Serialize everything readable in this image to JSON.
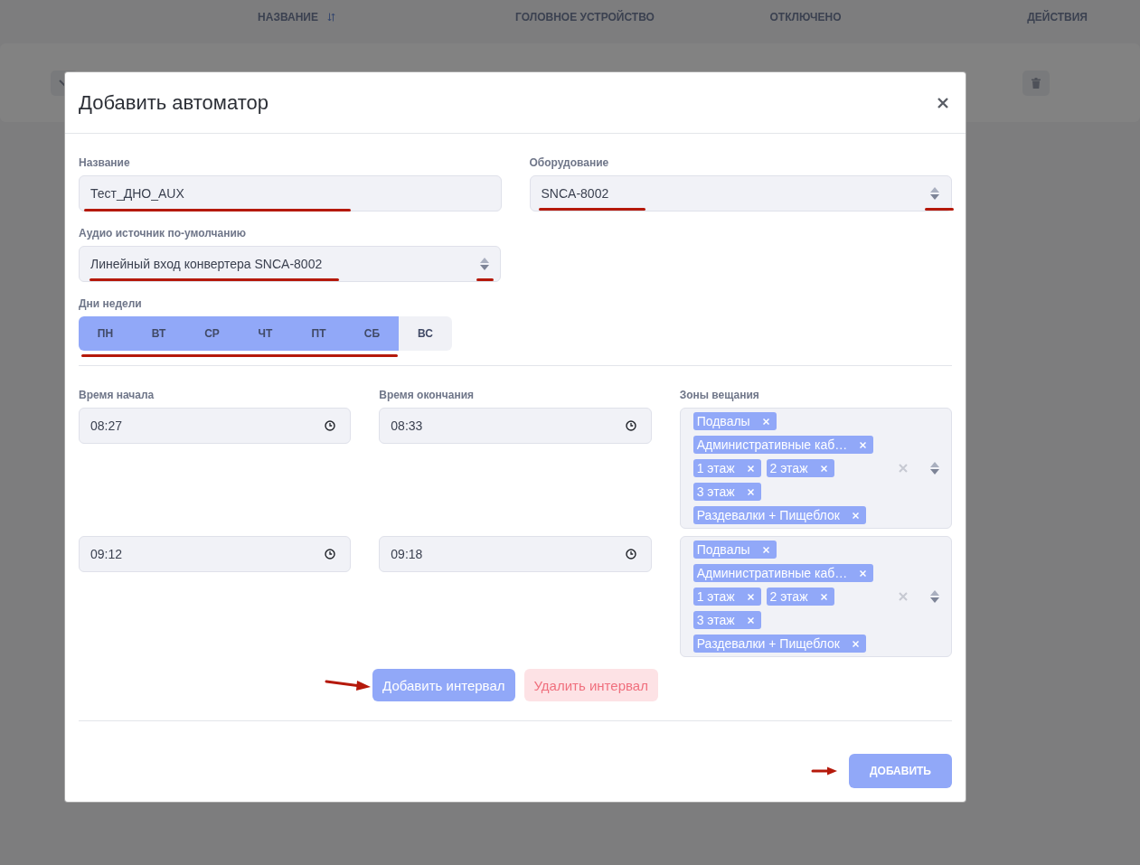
{
  "background_table": {
    "columns": [
      {
        "label": "НАЗВАНИЕ",
        "sortable": true
      },
      {
        "label": "ГОЛОВНОЕ УСТРОЙСТВО",
        "sortable": false
      },
      {
        "label": "ОТКЛЮЧЕНО",
        "sortable": false
      },
      {
        "label": "ДЕЙСТВИЯ",
        "sortable": false
      }
    ]
  },
  "dialog": {
    "title": "Добавить автоматор",
    "name_field": {
      "label": "Название",
      "value": "Тест_ДНО_AUX",
      "marked": true
    },
    "equipment_select": {
      "label": "Оборудование",
      "value": "SNCA-8002",
      "marked": true
    },
    "audio_source_select": {
      "label": "Аудио источник по-умолчанию",
      "value": "Линейный вход конвертера SNCA-8002",
      "marked": true
    },
    "weekdays": {
      "label": "Дни недели",
      "marked": true,
      "days": [
        {
          "label": "ПН",
          "selected": true
        },
        {
          "label": "ВТ",
          "selected": true
        },
        {
          "label": "СР",
          "selected": true
        },
        {
          "label": "ЧТ",
          "selected": true
        },
        {
          "label": "ПТ",
          "selected": true
        },
        {
          "label": "СБ",
          "selected": true
        },
        {
          "label": "ВС",
          "selected": false
        }
      ]
    },
    "intervals": {
      "columns": [
        "Время начала",
        "Время окончания",
        "Зоны вещания"
      ],
      "rows": [
        {
          "start": "08:27",
          "end": "08:33",
          "zones": [
            "Подвалы",
            "Административные каб…",
            "1 этаж",
            "2 этаж",
            "3 этаж",
            "Раздевалки + Пищеблок"
          ]
        },
        {
          "start": "09:12",
          "end": "09:18",
          "zones": [
            "Подвалы",
            "Административные каб…",
            "1 этаж",
            "2 этаж",
            "3 этаж",
            "Раздевалки + Пищеблок"
          ]
        }
      ]
    },
    "interval_actions": [
      {
        "kind": "add",
        "label": "Добавить интервал",
        "marked": true
      },
      {
        "kind": "remove",
        "label": "Удалить интервал",
        "marked": false
      }
    ],
    "submit": {
      "label": "ДОБАВИТЬ",
      "marked": true
    }
  }
}
